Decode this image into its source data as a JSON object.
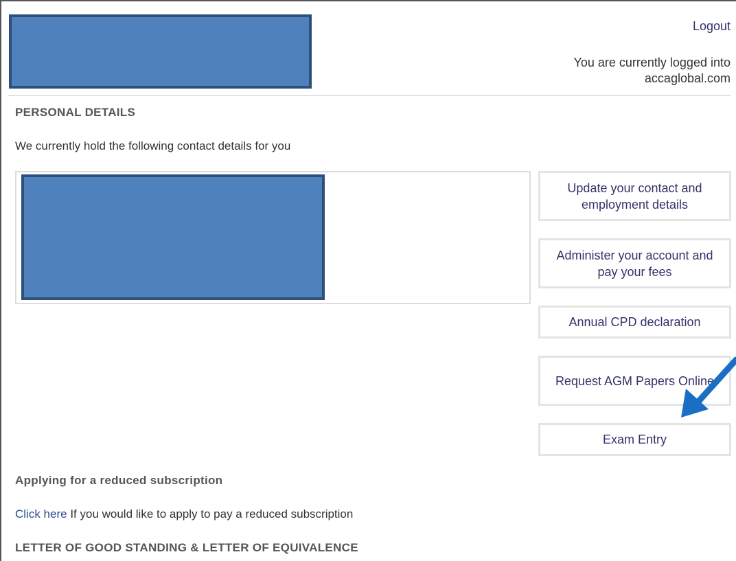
{
  "header": {
    "logout_label": "Logout",
    "login_status": "You are currently logged into accaglobal.com"
  },
  "personal_details": {
    "heading": "PERSONAL DETAILS",
    "intro": "We currently hold the following contact details for you"
  },
  "actions": [
    {
      "label": "Update your contact and employment details"
    },
    {
      "label": "Administer your account and pay your fees"
    },
    {
      "label": "Annual CPD declaration"
    },
    {
      "label": "Request AGM Papers Online"
    },
    {
      "label": "Exam Entry"
    }
  ],
  "reduced_subscription": {
    "heading": "Applying for a reduced subscription",
    "link_label": "Click here",
    "description": " If you would like to apply to pay a reduced subscription"
  },
  "letter_section": {
    "heading": "LETTER OF GOOD STANDING & LETTER OF EQUIVALENCE"
  },
  "colors": {
    "redaction_fill": "#4f81bd",
    "annotation_arrow": "#1a6fc4"
  },
  "annotation": {
    "icon": "arrow-pointing-down-left",
    "target": "Exam Entry"
  }
}
